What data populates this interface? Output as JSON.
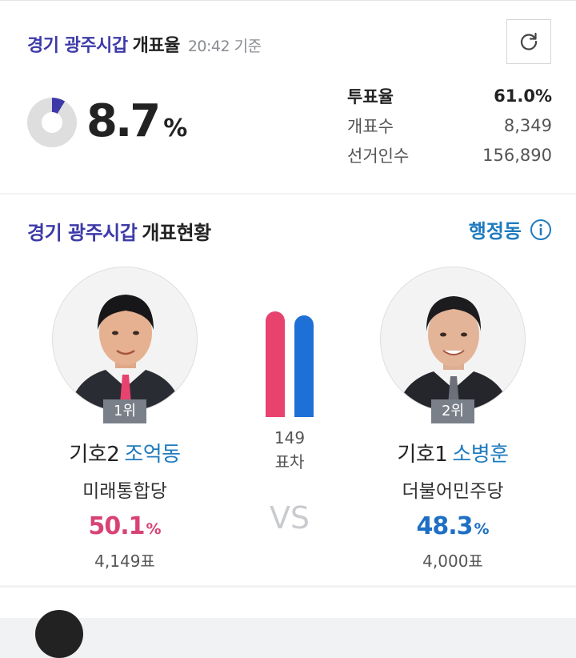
{
  "header": {
    "region": "경기 광주시갑",
    "title": "개표율",
    "time": "20:42 기준",
    "refresh_icon": "refresh-icon"
  },
  "counting": {
    "rate_value": "8.7",
    "rate_unit": "%",
    "rate_fraction": 0.087,
    "stats": [
      {
        "label": "투표율",
        "value": "61.0%"
      },
      {
        "label": "개표수",
        "value": "8,349"
      },
      {
        "label": "선거인수",
        "value": "156,890"
      }
    ]
  },
  "status": {
    "region": "경기 광주시갑",
    "title": "개표현황",
    "link_label": "행정동",
    "info_icon": "info-icon"
  },
  "candidates": [
    {
      "rank": "1위",
      "number": "기호2",
      "name": "조억동",
      "party": "미래통합당",
      "percent": "50.1",
      "unit": "%",
      "votes": "4,149표"
    },
    {
      "rank": "2위",
      "number": "기호1",
      "name": "소병훈",
      "party": "더불어민주당",
      "percent": "48.3",
      "unit": "%",
      "votes": "4,000표"
    }
  ],
  "comparison": {
    "diff_value": "149",
    "diff_label": "표차",
    "vs_label": "VS",
    "bar_ratio": [
      0.501,
      0.483
    ]
  },
  "colors": {
    "accent": "#3d3aa8",
    "party_red": "#e8426f",
    "party_blue": "#1e6fd6",
    "link": "#1f7bbf",
    "donut_track": "#dedede"
  }
}
